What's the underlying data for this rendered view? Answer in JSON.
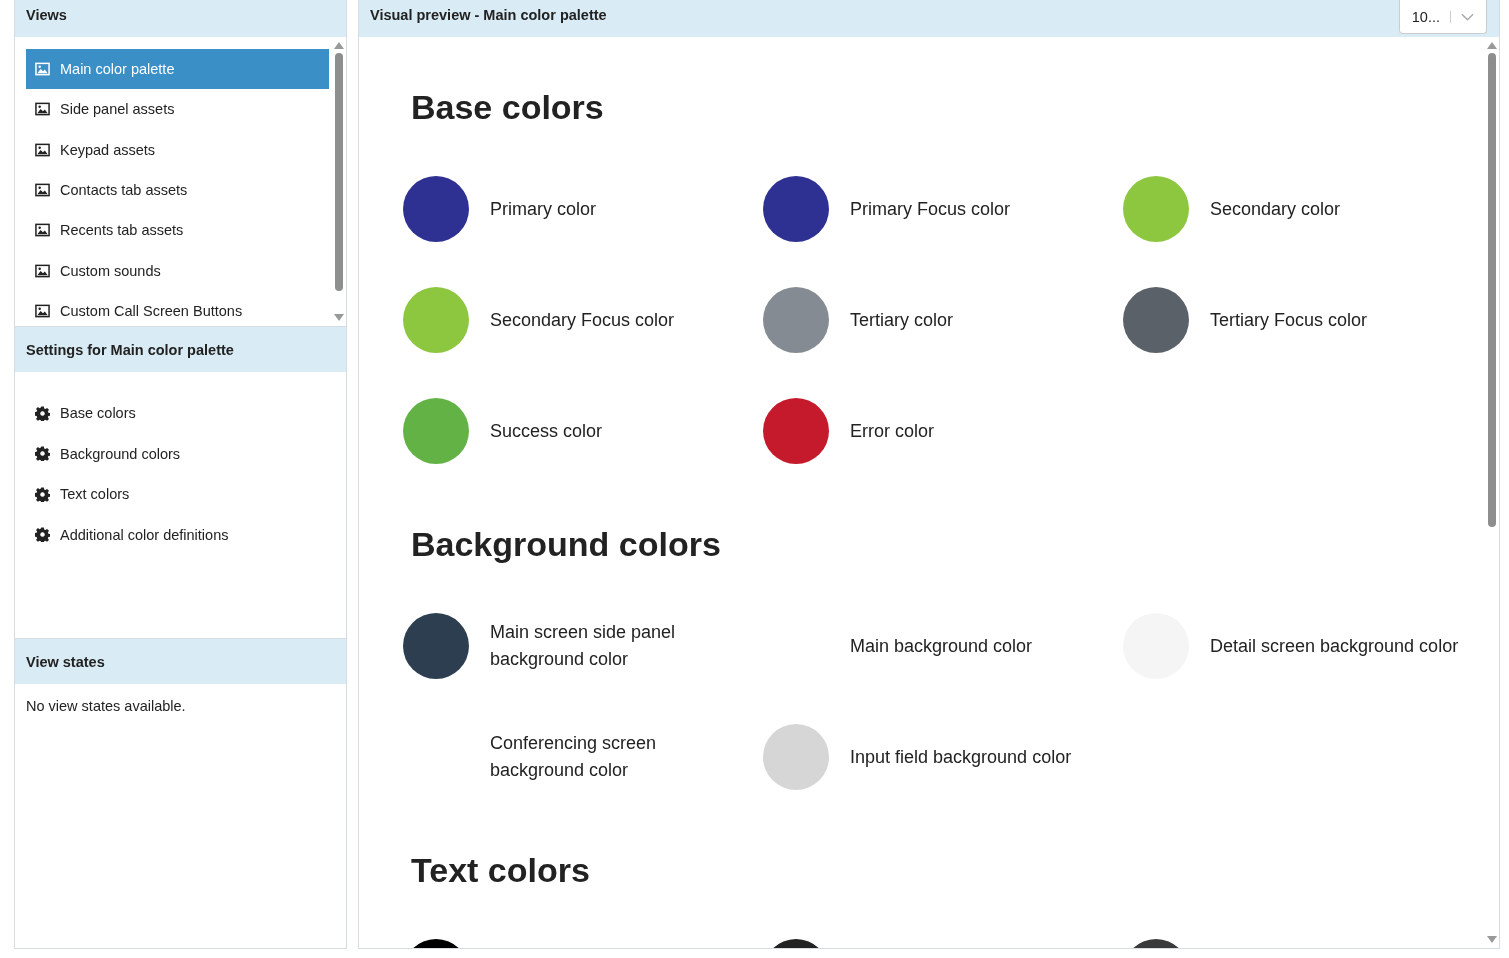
{
  "views": {
    "title": "Views",
    "items": [
      {
        "label": "Main color palette",
        "selected": true
      },
      {
        "label": "Side panel assets",
        "selected": false
      },
      {
        "label": "Keypad assets",
        "selected": false
      },
      {
        "label": "Contacts tab assets",
        "selected": false
      },
      {
        "label": "Recents tab assets",
        "selected": false
      },
      {
        "label": "Custom sounds",
        "selected": false
      },
      {
        "label": "Custom Call Screen Buttons",
        "selected": false
      }
    ]
  },
  "settings": {
    "title": "Settings for Main color palette",
    "items": [
      {
        "label": "Base colors"
      },
      {
        "label": "Background colors"
      },
      {
        "label": "Text colors"
      },
      {
        "label": "Additional color definitions"
      }
    ]
  },
  "view_states": {
    "title": "View states",
    "message": "No view states available."
  },
  "preview": {
    "title": "Visual preview - Main color palette",
    "zoom_select": {
      "value": "10..."
    },
    "sections": [
      {
        "title": "Base colors",
        "swatches": [
          {
            "label": "Primary color",
            "color": "#2e3192"
          },
          {
            "label": "Primary Focus color",
            "color": "#2e3192"
          },
          {
            "label": "Secondary color",
            "color": "#8dc63f"
          },
          {
            "label": "Secondary Focus color",
            "color": "#8dc63f"
          },
          {
            "label": "Tertiary color",
            "color": "#858b93"
          },
          {
            "label": "Tertiary Focus color",
            "color": "#5b6169"
          },
          {
            "label": "Success color",
            "color": "#62b246"
          },
          {
            "label": "Error color",
            "color": "#c41a2b"
          }
        ]
      },
      {
        "title": "Background colors",
        "swatches": [
          {
            "label": "Main screen side panel background color",
            "color": "#2d3e50"
          },
          {
            "label": "Main background color"
          },
          {
            "label": "Detail screen background color",
            "color": "#f5f5f5"
          },
          {
            "label": "Conferencing screen background color"
          },
          {
            "label": "Input field background color",
            "color": "#d6d6d6"
          }
        ]
      },
      {
        "title": "Text colors",
        "swatches": [
          {
            "color": "#000000"
          },
          {
            "color": "#222222"
          },
          {
            "color": "#3a3a3a"
          }
        ]
      }
    ]
  }
}
